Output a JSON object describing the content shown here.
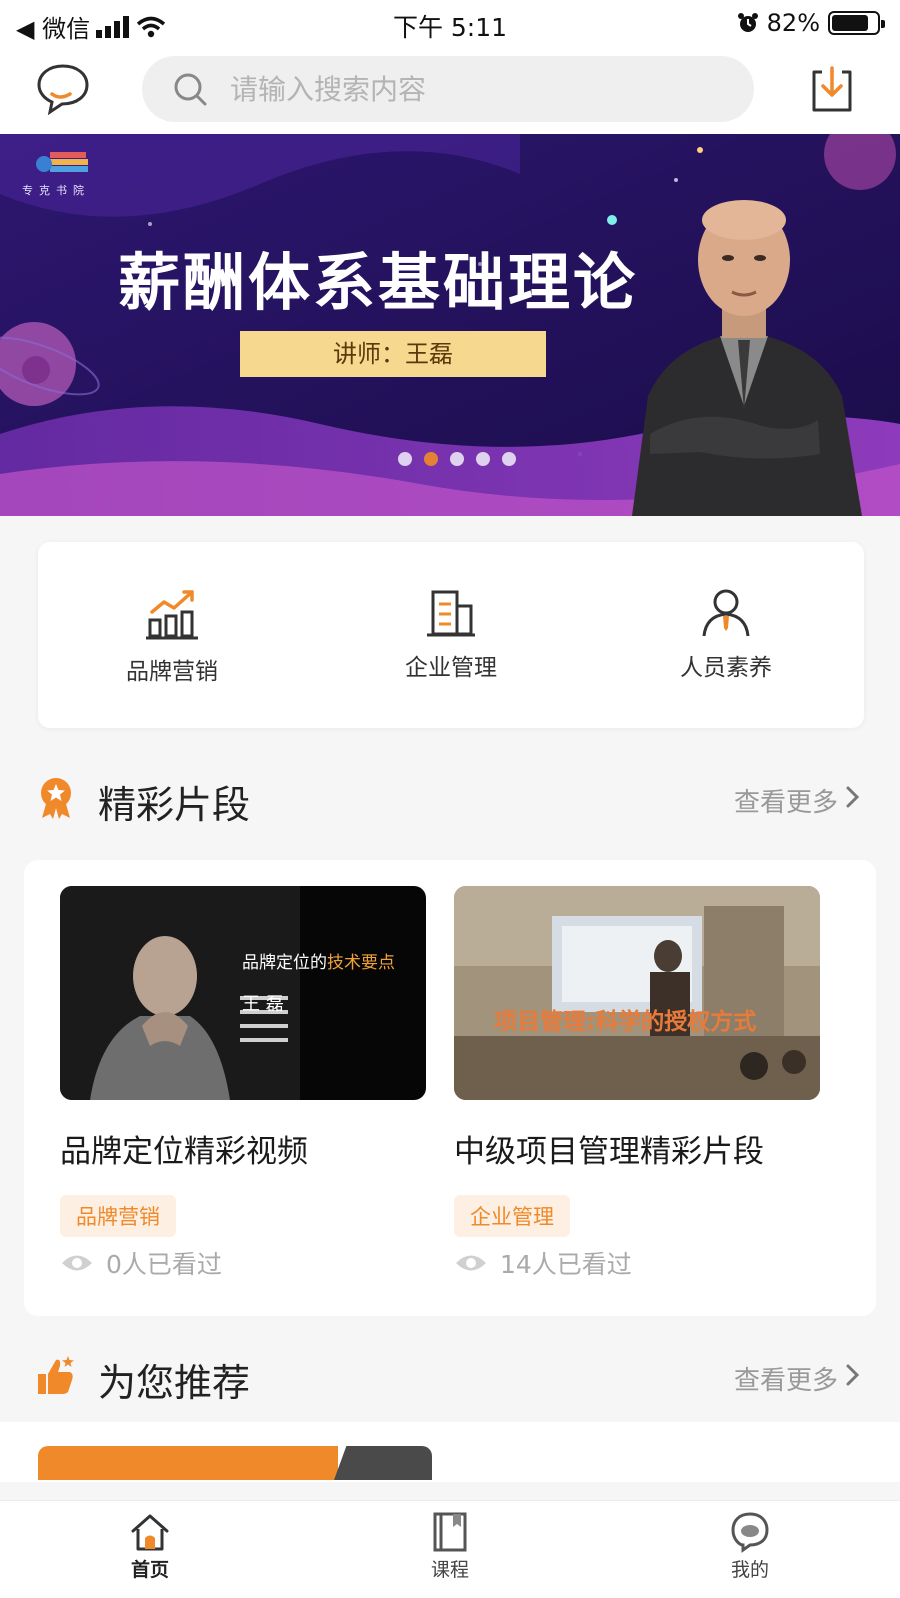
{
  "status_bar": {
    "carrier": "◀ 微信",
    "time": "下午 5:11",
    "battery": "82%",
    "battery_level": 0.82
  },
  "header": {
    "search_placeholder": "请输入搜索内容"
  },
  "banner": {
    "logo_text": "专克书院",
    "title": "薪酬体系基础理论",
    "instructor": "讲师：王磊",
    "dot_count": 5,
    "active_dot": 1
  },
  "categories": [
    {
      "label": "品牌营销",
      "icon": "chart-growth-icon"
    },
    {
      "label": "企业管理",
      "icon": "building-icon"
    },
    {
      "label": "人员素养",
      "icon": "person-icon"
    }
  ],
  "highlights": {
    "title": "精彩片段",
    "more": "查看更多",
    "items": [
      {
        "title": "品牌定位精彩视频",
        "tag": "品牌营销",
        "views": "0人已看过",
        "thumb_text": {
          "line1a": "品牌定位的",
          "line1b": "技术要点",
          "name": "王 磊"
        }
      },
      {
        "title": "中级项目管理精彩片段",
        "tag": "企业管理",
        "views": "14人已看过",
        "thumb_text": {
          "caption": "项目管理:科学的授权方式"
        }
      }
    ]
  },
  "recommend": {
    "title": "为您推荐",
    "more": "查看更多"
  },
  "tabs": [
    {
      "label": "首页",
      "icon": "home-icon",
      "active": true
    },
    {
      "label": "课程",
      "icon": "book-icon",
      "active": false
    },
    {
      "label": "我的",
      "icon": "profile-icon",
      "active": false
    }
  ],
  "colors": {
    "accent": "#f0892a",
    "banner_bg": "#2a1560",
    "banner_tag_bg": "#f6d88e"
  }
}
